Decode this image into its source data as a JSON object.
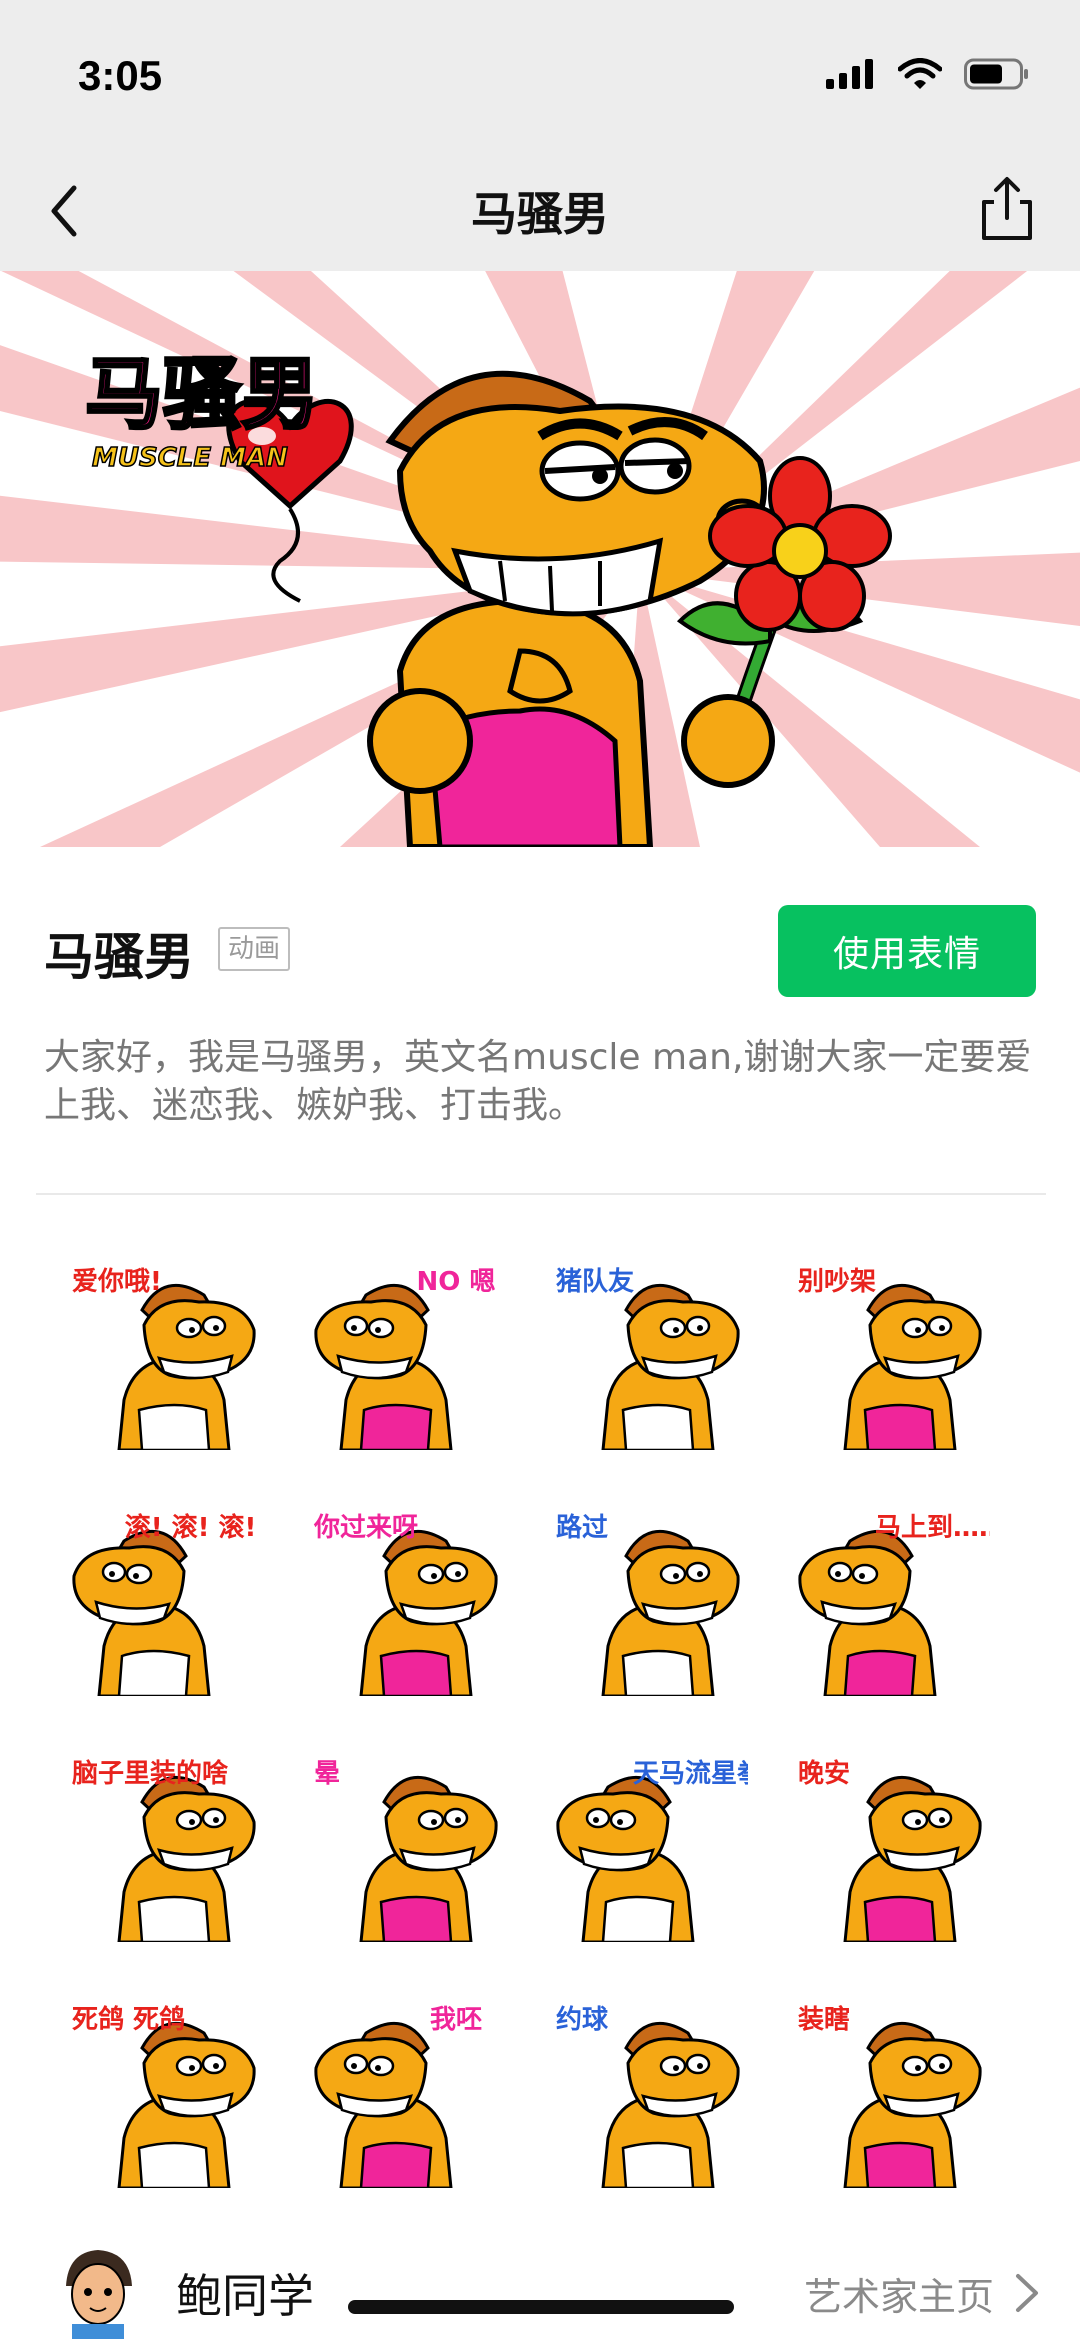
{
  "status": {
    "time": "3:05"
  },
  "nav": {
    "title": "马骚男"
  },
  "banner": {
    "logo_text": "马骚男",
    "logo_subtext": "MUSCLE MAN"
  },
  "pack": {
    "title": "马骚男",
    "badge": "动画",
    "use_button": "使用表情",
    "description": "大家好，我是马骚男，英文名muscle man,谢谢大家一定要爱上我、迷恋我、嫉妒我、打击我。"
  },
  "stickers": [
    {
      "caption": "爱你哦!"
    },
    {
      "caption": "NO 嗯"
    },
    {
      "caption": "猪队友"
    },
    {
      "caption": "别吵架"
    },
    {
      "caption": "滚! 滚! 滚! 滚!"
    },
    {
      "caption": "你过来呀"
    },
    {
      "caption": "路过"
    },
    {
      "caption": "马上到……"
    },
    {
      "caption": "脑子里装的啥"
    },
    {
      "caption": "晕"
    },
    {
      "caption": "天马流星拳"
    },
    {
      "caption": "晚安"
    },
    {
      "caption": "死鸽 死鸽"
    },
    {
      "caption": "我呸"
    },
    {
      "caption": "约球"
    },
    {
      "caption": "装瞎"
    }
  ],
  "artist": {
    "name": "鲍同学",
    "link": "艺术家主页"
  },
  "colors": {
    "accent": "#07c160",
    "horse": "#f5a814",
    "mane": "#c86a17",
    "banner_ray": "#f8c6c8"
  }
}
